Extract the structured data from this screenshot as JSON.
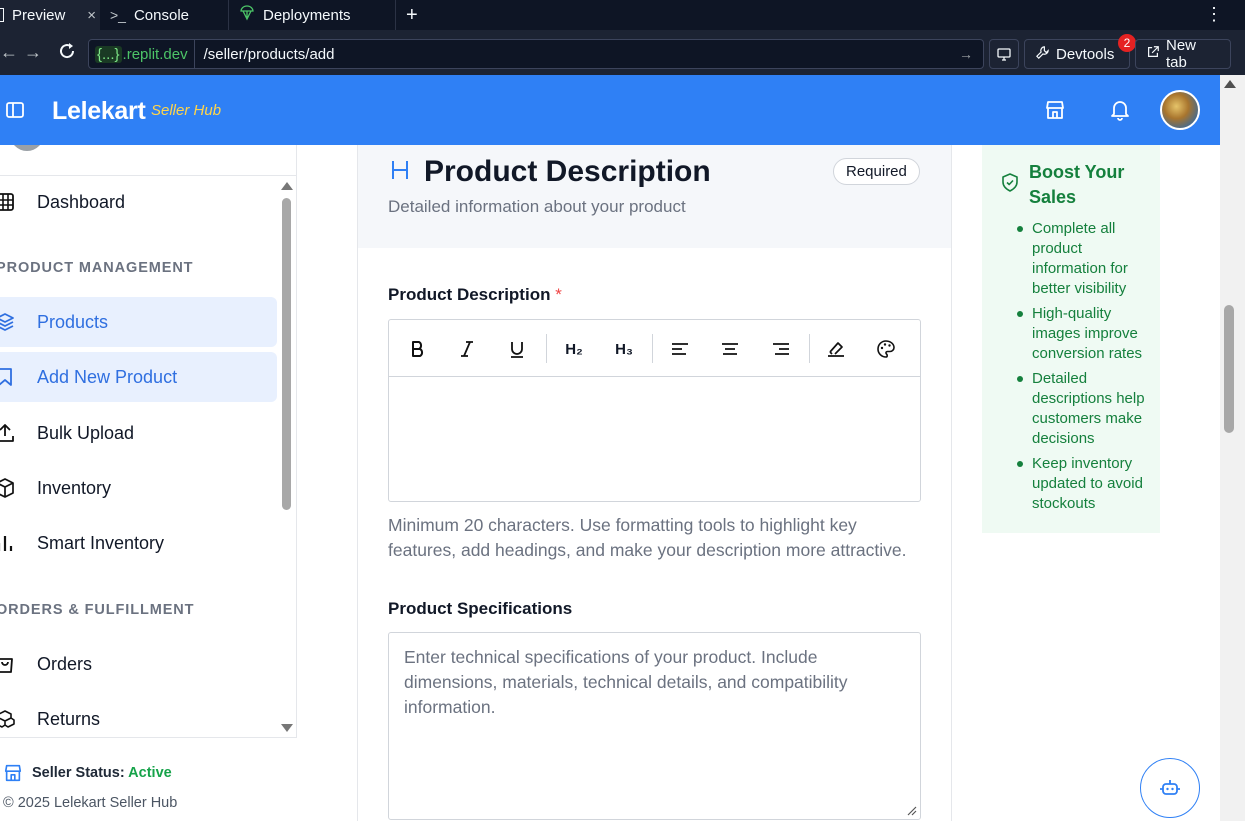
{
  "browser": {
    "tabs": [
      {
        "label": "Preview",
        "icon": "preview-icon"
      },
      {
        "label": "Console",
        "icon": "terminal-icon"
      },
      {
        "label": "Deployments",
        "icon": "deployments-icon"
      }
    ],
    "domain_braces": "{...}",
    "domain": ".replit.dev",
    "path": "/seller/products/add",
    "devtools_label": "Devtools",
    "devtools_badge": "2",
    "newtab_label": "New tab"
  },
  "header": {
    "brand": "Lelekart",
    "brand_sub": "Seller Hub",
    "accent_color": "#2f80f5"
  },
  "sidebar": {
    "sections": [
      {
        "title": "PRODUCT MANAGEMENT"
      },
      {
        "title": "ORDERS & FULFILLMENT"
      }
    ],
    "items": [
      {
        "label": "Dashboard",
        "icon": "grid-icon"
      },
      {
        "label": "Products",
        "icon": "layers-icon"
      },
      {
        "label": "Add New Product",
        "icon": "bookmark-icon"
      },
      {
        "label": "Bulk Upload",
        "icon": "upload-icon"
      },
      {
        "label": "Inventory",
        "icon": "package-icon"
      },
      {
        "label": "Smart Inventory",
        "icon": "bar-chart-icon"
      },
      {
        "label": "Orders",
        "icon": "shopping-bag-icon"
      },
      {
        "label": "Returns",
        "icon": "boxes-icon"
      }
    ],
    "status_label": "Seller Status:",
    "status_value": "Active",
    "copyright": "© 2025 Lelekart Seller Hub"
  },
  "card": {
    "title": "Product Description",
    "subtitle": "Detailed information about your product",
    "required_badge": "Required",
    "description_label": "Product Description",
    "required_star": "*",
    "toolbar": [
      "bold-icon",
      "italic-icon",
      "underline-icon",
      "heading2-icon",
      "heading3-icon",
      "align-left-icon",
      "align-center-icon",
      "align-right-icon",
      "clear-format-icon",
      "palette-icon"
    ],
    "toolbar_h2": "H₂",
    "toolbar_h3": "H₃",
    "helper": "Minimum 20 characters. Use formatting tools to highlight key features, add headings, and make your description more attractive.",
    "specs_label": "Product Specifications",
    "specs_placeholder": "Enter technical specifications of your product. Include dimensions, materials, technical details, and compatibility information."
  },
  "tips": {
    "title": "Boost Your Sales",
    "items": [
      "Complete all product information for better visibility",
      "High-quality images improve conversion rates",
      "Detailed descriptions help customers make decisions",
      "Keep inventory updated to avoid stockouts"
    ]
  }
}
